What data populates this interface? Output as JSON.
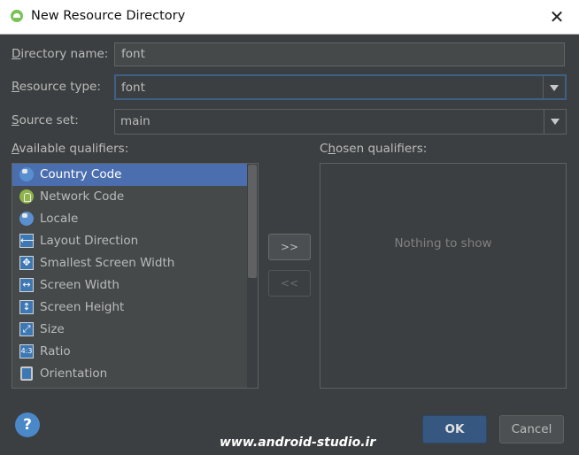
{
  "dialog": {
    "title": "New Resource Directory"
  },
  "directory_name": {
    "label_first": "D",
    "label_rest": "irectory name:",
    "value": "font"
  },
  "resource_type": {
    "label_first": "R",
    "label_rest": "esource type:",
    "value": "font"
  },
  "source_set": {
    "label_first": "S",
    "label_rest": "ource set:",
    "value": "main"
  },
  "available": {
    "label_first": "A",
    "label_rest": "vailable qualifiers:",
    "items": [
      {
        "label": "Country Code",
        "icon": "country-code-icon"
      },
      {
        "label": "Network Code",
        "icon": "network-code-icon"
      },
      {
        "label": "Locale",
        "icon": "locale-icon"
      },
      {
        "label": "Layout Direction",
        "icon": "layout-direction-icon"
      },
      {
        "label": "Smallest Screen Width",
        "icon": "smallest-screen-width-icon"
      },
      {
        "label": "Screen Width",
        "icon": "screen-width-icon"
      },
      {
        "label": "Screen Height",
        "icon": "screen-height-icon"
      },
      {
        "label": "Size",
        "icon": "size-icon"
      },
      {
        "label": "Ratio",
        "icon": "ratio-icon"
      },
      {
        "label": "Orientation",
        "icon": "orientation-icon"
      }
    ],
    "selected_index": 0
  },
  "chosen": {
    "label_prefix": "C",
    "label_first": "h",
    "label_rest": "osen qualifiers:",
    "empty_text": "Nothing to show"
  },
  "buttons": {
    "add": ">>",
    "remove": "<<",
    "ok": "OK",
    "cancel": "Cancel",
    "help": "?"
  },
  "watermark": "www.android-studio.ir",
  "colors": {
    "background": "#3c3f41",
    "selection": "#4b6eaf",
    "focus_border": "#3d6185",
    "ok_button": "#365880"
  }
}
